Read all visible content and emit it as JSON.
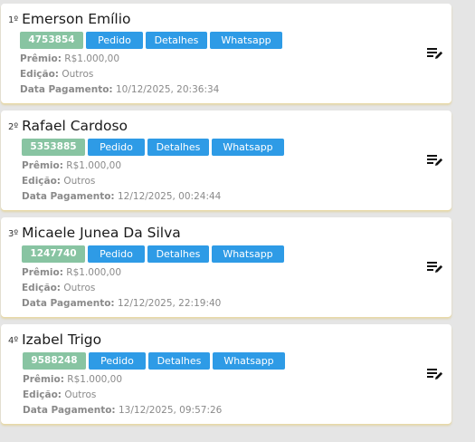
{
  "entries": [
    {
      "rank": "1º",
      "name": "Emerson Emílio",
      "code": "4753854",
      "buttons": [
        "Pedido",
        "Detalhes",
        "Whatsapp"
      ],
      "premio_label": "Prêmio:",
      "premio": "R$1.000,00",
      "edicao_label": "Edição:",
      "edicao": "Outros",
      "data_label": "Data Pagamento:",
      "data": "10/12/2025, 20:36:34",
      "edit_icon": "edit-list-icon"
    },
    {
      "rank": "2º",
      "name": "Rafael Cardoso",
      "code": "5353885",
      "buttons": [
        "Pedido",
        "Detalhes",
        "Whatsapp"
      ],
      "premio_label": "Prêmio:",
      "premio": "R$1.000,00",
      "edicao_label": "Edição:",
      "edicao": "Outros",
      "data_label": "Data Pagamento:",
      "data": "12/12/2025, 00:24:44",
      "edit_icon": "edit-list-icon"
    },
    {
      "rank": "3º",
      "name": "Micaele Junea Da Silva",
      "code": "1247740",
      "buttons": [
        "Pedido",
        "Detalhes",
        "Whatsapp"
      ],
      "premio_label": "Prêmio:",
      "premio": "R$1.000,00",
      "edicao_label": "Edição:",
      "edicao": "Outros",
      "data_label": "Data Pagamento:",
      "data": "12/12/2025, 22:19:40",
      "edit_icon": "edit-list-icon"
    },
    {
      "rank": "4º",
      "name": "Izabel Trigo",
      "code": "9588248",
      "buttons": [
        "Pedido",
        "Detalhes",
        "Whatsapp"
      ],
      "premio_label": "Prêmio:",
      "premio": "R$1.000,00",
      "edicao_label": "Edição:",
      "edicao": "Outros",
      "data_label": "Data Pagamento:",
      "data": "13/12/2025, 09:57:26",
      "edit_icon": "edit-list-icon"
    }
  ],
  "colors": {
    "code_badge": "#88c4a2",
    "action_button": "#2e9be6",
    "background": "#e5e5e5"
  }
}
